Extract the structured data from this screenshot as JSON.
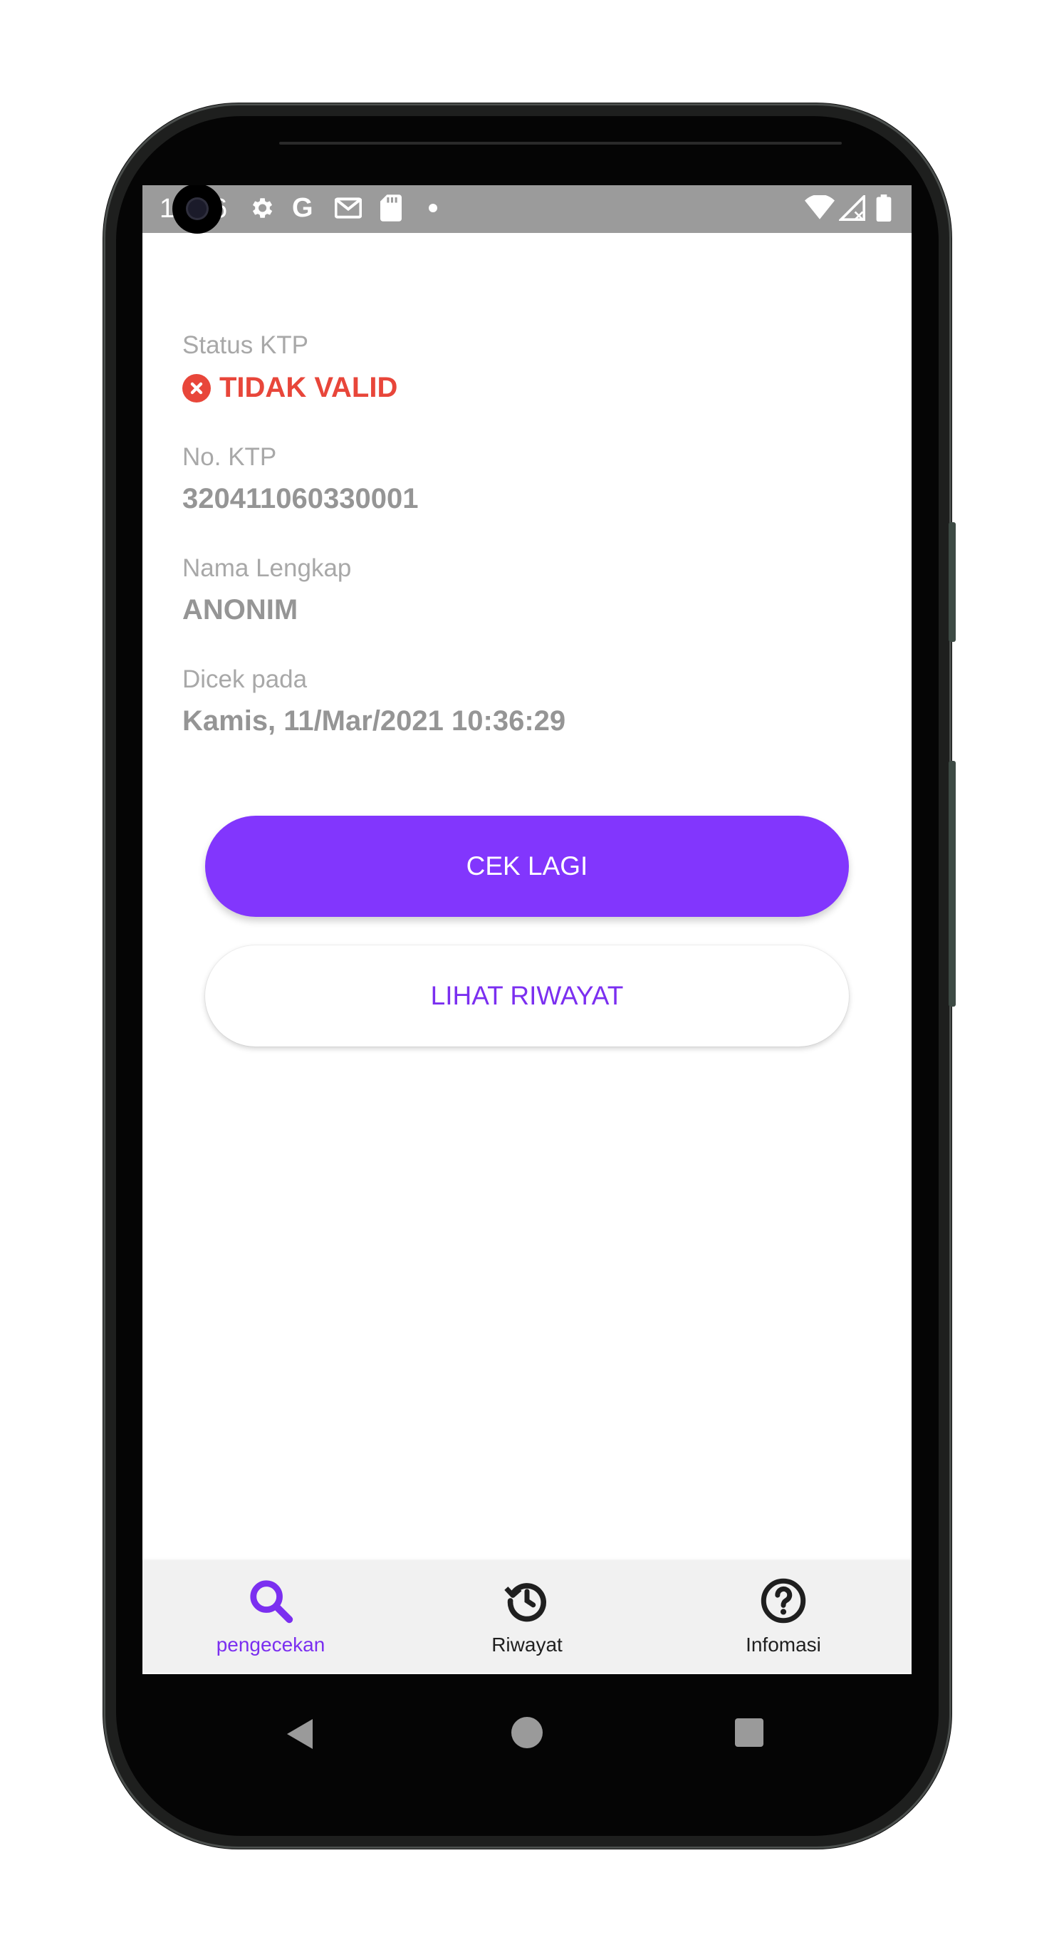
{
  "status_bar": {
    "time": "10:36",
    "icons": [
      "gear-icon",
      "google-icon",
      "gmail-icon",
      "sdcard-icon",
      "dot-icon",
      "wifi-icon",
      "signal-icon",
      "battery-icon"
    ]
  },
  "result": {
    "status_label": "Status KTP",
    "status_value": "TIDAK VALID",
    "status_icon": "error-x-icon",
    "ktp_label": "No. KTP",
    "ktp_value": "320411060330001",
    "name_label": "Nama Lengkap",
    "name_value": "ANONIM",
    "checked_label": "Dicek pada",
    "checked_value": "Kamis, 11/Mar/2021 10:36:29"
  },
  "actions": {
    "check_again": "CEK LAGI",
    "view_history": "LIHAT RIWAYAT"
  },
  "bottom_nav": {
    "items": [
      {
        "label": "pengecekan",
        "icon": "search-icon",
        "active": true
      },
      {
        "label": "Riwayat",
        "icon": "history-icon",
        "active": false
      },
      {
        "label": "Infomasi",
        "icon": "help-circle-icon",
        "active": false
      }
    ]
  },
  "system_nav": [
    "back-icon",
    "home-icon",
    "recents-icon"
  ],
  "colors": {
    "accent": "#8236fd",
    "error": "#e8463a",
    "label": "#a8a8a8",
    "value": "#959595"
  }
}
